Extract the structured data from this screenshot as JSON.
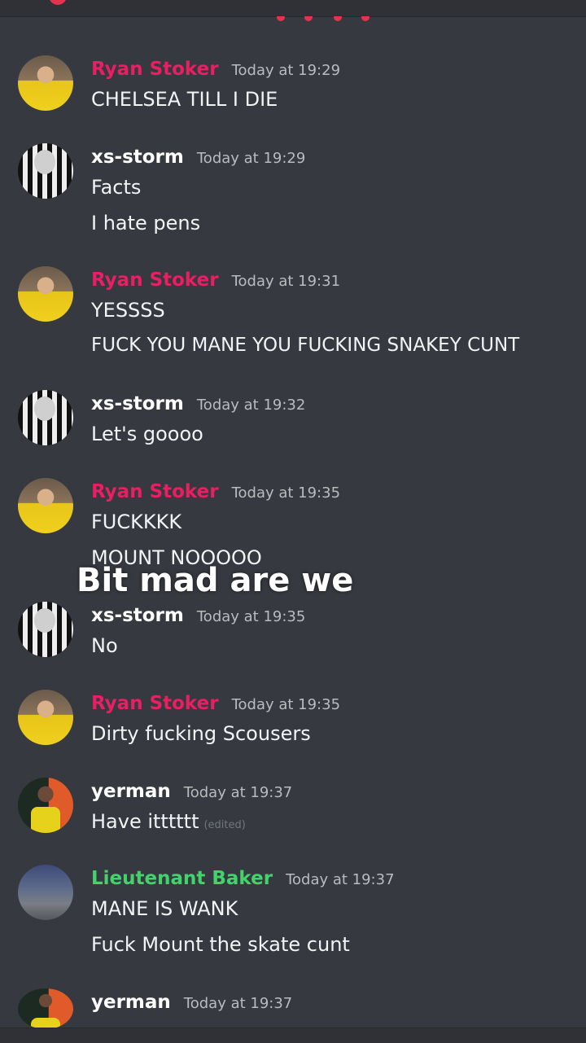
{
  "colors": {
    "ryan": "#e91e63",
    "storm": "#ffffff",
    "yerman": "#ffffff",
    "baker": "#43d36b"
  },
  "overlay_caption": "Bit mad are we",
  "messages": [
    {
      "author": "Ryan Stoker",
      "time": "Today at 19:29",
      "lines": [
        "CHELSEA TILL I DIE"
      ]
    },
    {
      "author": "xs-storm",
      "time": "Today at 19:29",
      "lines": [
        "Facts",
        "I hate pens"
      ]
    },
    {
      "author": "Ryan Stoker",
      "time": "Today at 19:31",
      "lines": [
        "YESSSS",
        "FUCK YOU MANE YOU FUCKING SNAKEY CUNT"
      ]
    },
    {
      "author": "xs-storm",
      "time": "Today at 19:32",
      "lines": [
        "Let's goooo"
      ]
    },
    {
      "author": "Ryan Stoker",
      "time": "Today at 19:35",
      "lines": [
        "FUCKKKK",
        "MOUNT NOOOOO"
      ]
    },
    {
      "author": "xs-storm",
      "time": "Today at 19:35",
      "lines": [
        "No"
      ]
    },
    {
      "author": "Ryan Stoker",
      "time": "Today at 19:35",
      "lines": [
        "Dirty fucking Scousers"
      ]
    },
    {
      "author": "yerman",
      "time": "Today at 19:37",
      "lines": [
        "Have itttttt"
      ],
      "edited": "(edited)"
    },
    {
      "author": "Lieutenant Baker",
      "time": "Today at 19:37",
      "lines": [
        "MANE IS WANK",
        "Fuck Mount the skate cunt"
      ]
    },
    {
      "author": "yerman",
      "time": "Today at 19:37",
      "lines": []
    }
  ]
}
